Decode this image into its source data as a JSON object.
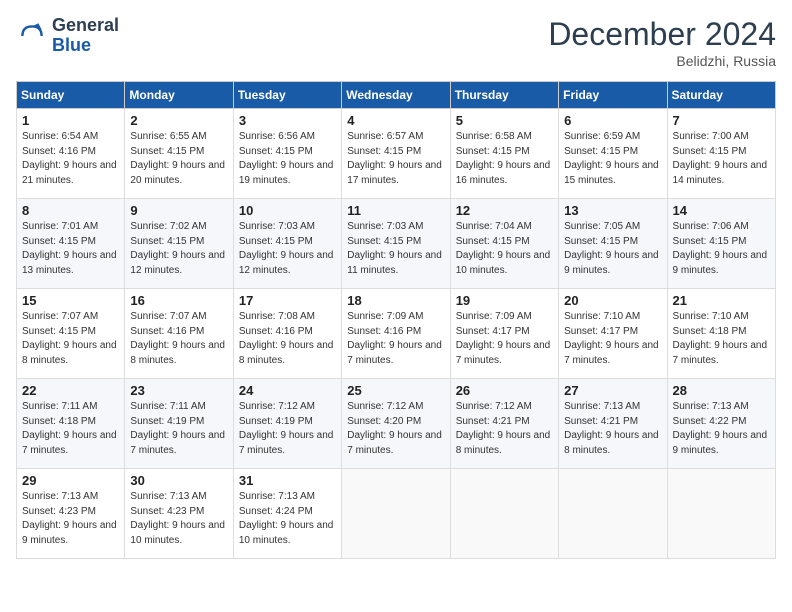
{
  "header": {
    "logo_line1": "General",
    "logo_line2": "Blue",
    "month_title": "December 2024",
    "location": "Belidzhi, Russia"
  },
  "days_of_week": [
    "Sunday",
    "Monday",
    "Tuesday",
    "Wednesday",
    "Thursday",
    "Friday",
    "Saturday"
  ],
  "weeks": [
    [
      {
        "day": "1",
        "sunrise": "6:54 AM",
        "sunset": "4:16 PM",
        "daylight": "9 hours and 21 minutes."
      },
      {
        "day": "2",
        "sunrise": "6:55 AM",
        "sunset": "4:15 PM",
        "daylight": "9 hours and 20 minutes."
      },
      {
        "day": "3",
        "sunrise": "6:56 AM",
        "sunset": "4:15 PM",
        "daylight": "9 hours and 19 minutes."
      },
      {
        "day": "4",
        "sunrise": "6:57 AM",
        "sunset": "4:15 PM",
        "daylight": "9 hours and 17 minutes."
      },
      {
        "day": "5",
        "sunrise": "6:58 AM",
        "sunset": "4:15 PM",
        "daylight": "9 hours and 16 minutes."
      },
      {
        "day": "6",
        "sunrise": "6:59 AM",
        "sunset": "4:15 PM",
        "daylight": "9 hours and 15 minutes."
      },
      {
        "day": "7",
        "sunrise": "7:00 AM",
        "sunset": "4:15 PM",
        "daylight": "9 hours and 14 minutes."
      }
    ],
    [
      {
        "day": "8",
        "sunrise": "7:01 AM",
        "sunset": "4:15 PM",
        "daylight": "9 hours and 13 minutes."
      },
      {
        "day": "9",
        "sunrise": "7:02 AM",
        "sunset": "4:15 PM",
        "daylight": "9 hours and 12 minutes."
      },
      {
        "day": "10",
        "sunrise": "7:03 AM",
        "sunset": "4:15 PM",
        "daylight": "9 hours and 12 minutes."
      },
      {
        "day": "11",
        "sunrise": "7:03 AM",
        "sunset": "4:15 PM",
        "daylight": "9 hours and 11 minutes."
      },
      {
        "day": "12",
        "sunrise": "7:04 AM",
        "sunset": "4:15 PM",
        "daylight": "9 hours and 10 minutes."
      },
      {
        "day": "13",
        "sunrise": "7:05 AM",
        "sunset": "4:15 PM",
        "daylight": "9 hours and 9 minutes."
      },
      {
        "day": "14",
        "sunrise": "7:06 AM",
        "sunset": "4:15 PM",
        "daylight": "9 hours and 9 minutes."
      }
    ],
    [
      {
        "day": "15",
        "sunrise": "7:07 AM",
        "sunset": "4:15 PM",
        "daylight": "9 hours and 8 minutes."
      },
      {
        "day": "16",
        "sunrise": "7:07 AM",
        "sunset": "4:16 PM",
        "daylight": "9 hours and 8 minutes."
      },
      {
        "day": "17",
        "sunrise": "7:08 AM",
        "sunset": "4:16 PM",
        "daylight": "9 hours and 8 minutes."
      },
      {
        "day": "18",
        "sunrise": "7:09 AM",
        "sunset": "4:16 PM",
        "daylight": "9 hours and 7 minutes."
      },
      {
        "day": "19",
        "sunrise": "7:09 AM",
        "sunset": "4:17 PM",
        "daylight": "9 hours and 7 minutes."
      },
      {
        "day": "20",
        "sunrise": "7:10 AM",
        "sunset": "4:17 PM",
        "daylight": "9 hours and 7 minutes."
      },
      {
        "day": "21",
        "sunrise": "7:10 AM",
        "sunset": "4:18 PM",
        "daylight": "9 hours and 7 minutes."
      }
    ],
    [
      {
        "day": "22",
        "sunrise": "7:11 AM",
        "sunset": "4:18 PM",
        "daylight": "9 hours and 7 minutes."
      },
      {
        "day": "23",
        "sunrise": "7:11 AM",
        "sunset": "4:19 PM",
        "daylight": "9 hours and 7 minutes."
      },
      {
        "day": "24",
        "sunrise": "7:12 AM",
        "sunset": "4:19 PM",
        "daylight": "9 hours and 7 minutes."
      },
      {
        "day": "25",
        "sunrise": "7:12 AM",
        "sunset": "4:20 PM",
        "daylight": "9 hours and 7 minutes."
      },
      {
        "day": "26",
        "sunrise": "7:12 AM",
        "sunset": "4:21 PM",
        "daylight": "9 hours and 8 minutes."
      },
      {
        "day": "27",
        "sunrise": "7:13 AM",
        "sunset": "4:21 PM",
        "daylight": "9 hours and 8 minutes."
      },
      {
        "day": "28",
        "sunrise": "7:13 AM",
        "sunset": "4:22 PM",
        "daylight": "9 hours and 9 minutes."
      }
    ],
    [
      {
        "day": "29",
        "sunrise": "7:13 AM",
        "sunset": "4:23 PM",
        "daylight": "9 hours and 9 minutes."
      },
      {
        "day": "30",
        "sunrise": "7:13 AM",
        "sunset": "4:23 PM",
        "daylight": "9 hours and 10 minutes."
      },
      {
        "day": "31",
        "sunrise": "7:13 AM",
        "sunset": "4:24 PM",
        "daylight": "9 hours and 10 minutes."
      },
      null,
      null,
      null,
      null
    ]
  ]
}
